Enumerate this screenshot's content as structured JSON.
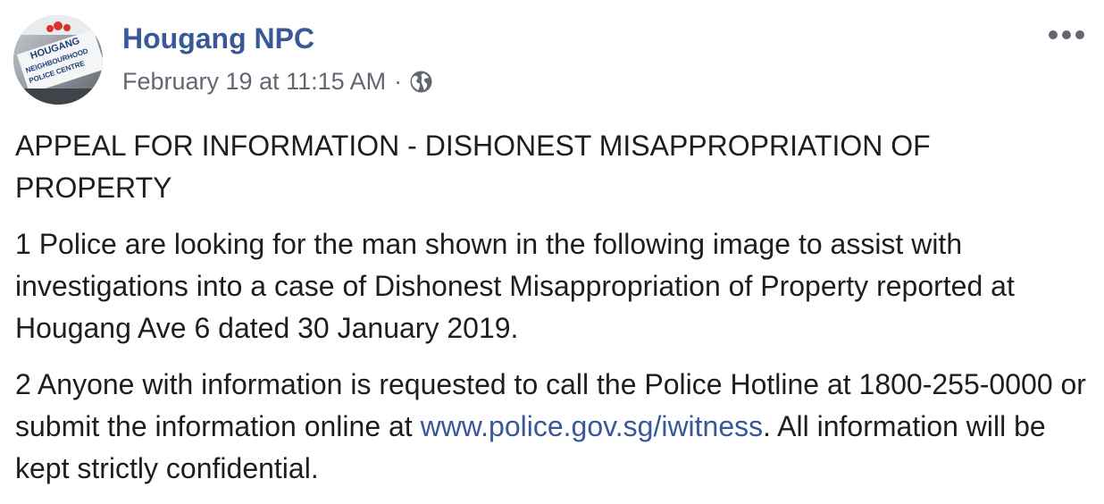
{
  "post": {
    "author": "Hougang NPC",
    "timestamp": "February 19 at 11:15 AM",
    "separator": "·",
    "privacy_icon": "globe-icon",
    "avatar_text": [
      "HOUGANG",
      "NEIGHBOURHOOD",
      "POLICE CENTRE"
    ],
    "more_icon": "more-options-icon",
    "heading": "APPEAL FOR INFORMATION - DISHONEST MISAPPROPRIATION OF PROPERTY",
    "para1": "1 Police are looking for the man shown in the following image to assist with investigations into a case of Dishonest Misappropriation of Property reported at Hougang Ave 6 dated 30 January 2019.",
    "para2_before": "2 Anyone with information is requested to call the Police Hotline at 1800-255-0000 or submit the information online at ",
    "para2_link": "www.police.gov.sg/iwitness",
    "para2_after": ". All information will be kept strictly confidential."
  },
  "colors": {
    "author": "#385898",
    "link": "#385898",
    "meta": "#616770",
    "text": "#1c1e21"
  }
}
